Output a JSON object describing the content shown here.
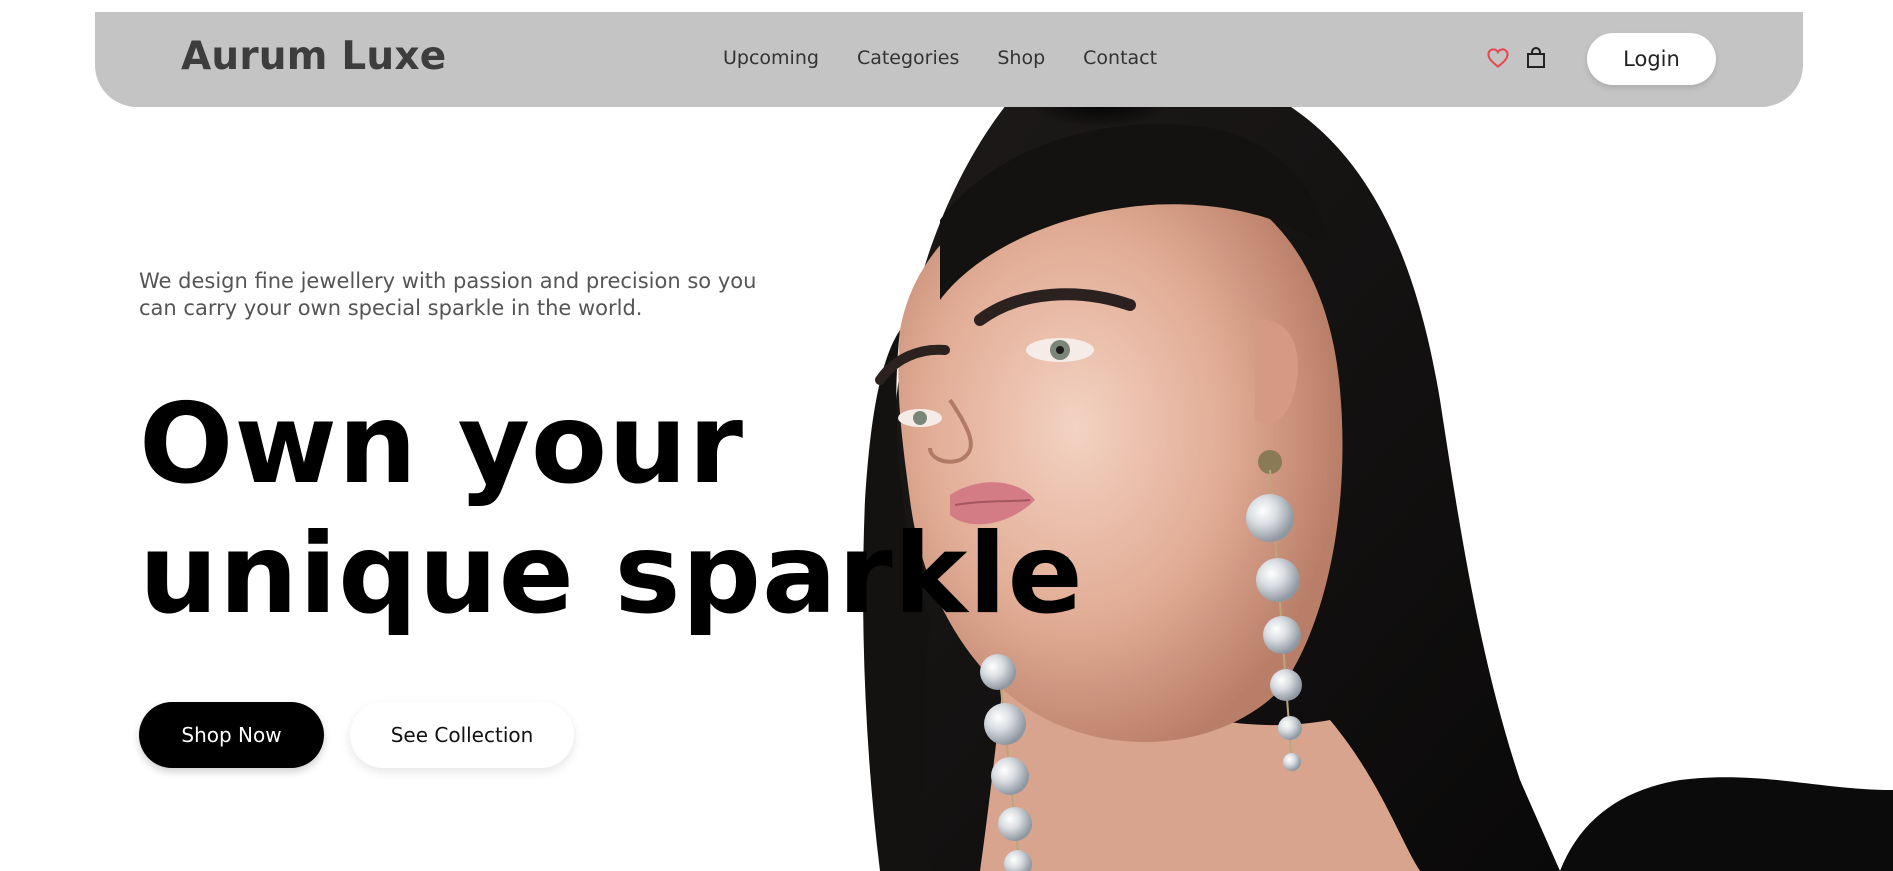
{
  "brand": {
    "name": "Aurum Luxe"
  },
  "nav": {
    "links": [
      "Upcoming",
      "Categories",
      "Shop",
      "Contact"
    ],
    "icons": [
      "heart-icon",
      "shopping-bag-icon"
    ],
    "login_label": "Login"
  },
  "hero": {
    "tagline": "We design fine jewellery with passion and precision so you can carry your own special sparkle in the world.",
    "headline_line1": "Own your",
    "headline_line2": "unique sparkle",
    "primary_cta": "Shop Now",
    "secondary_cta": "See Collection"
  },
  "colors": {
    "navbar_bg": "#c4c4c4",
    "heart_accent": "#e8444d",
    "primary_button": "#000000",
    "text_dark": "#000000"
  }
}
